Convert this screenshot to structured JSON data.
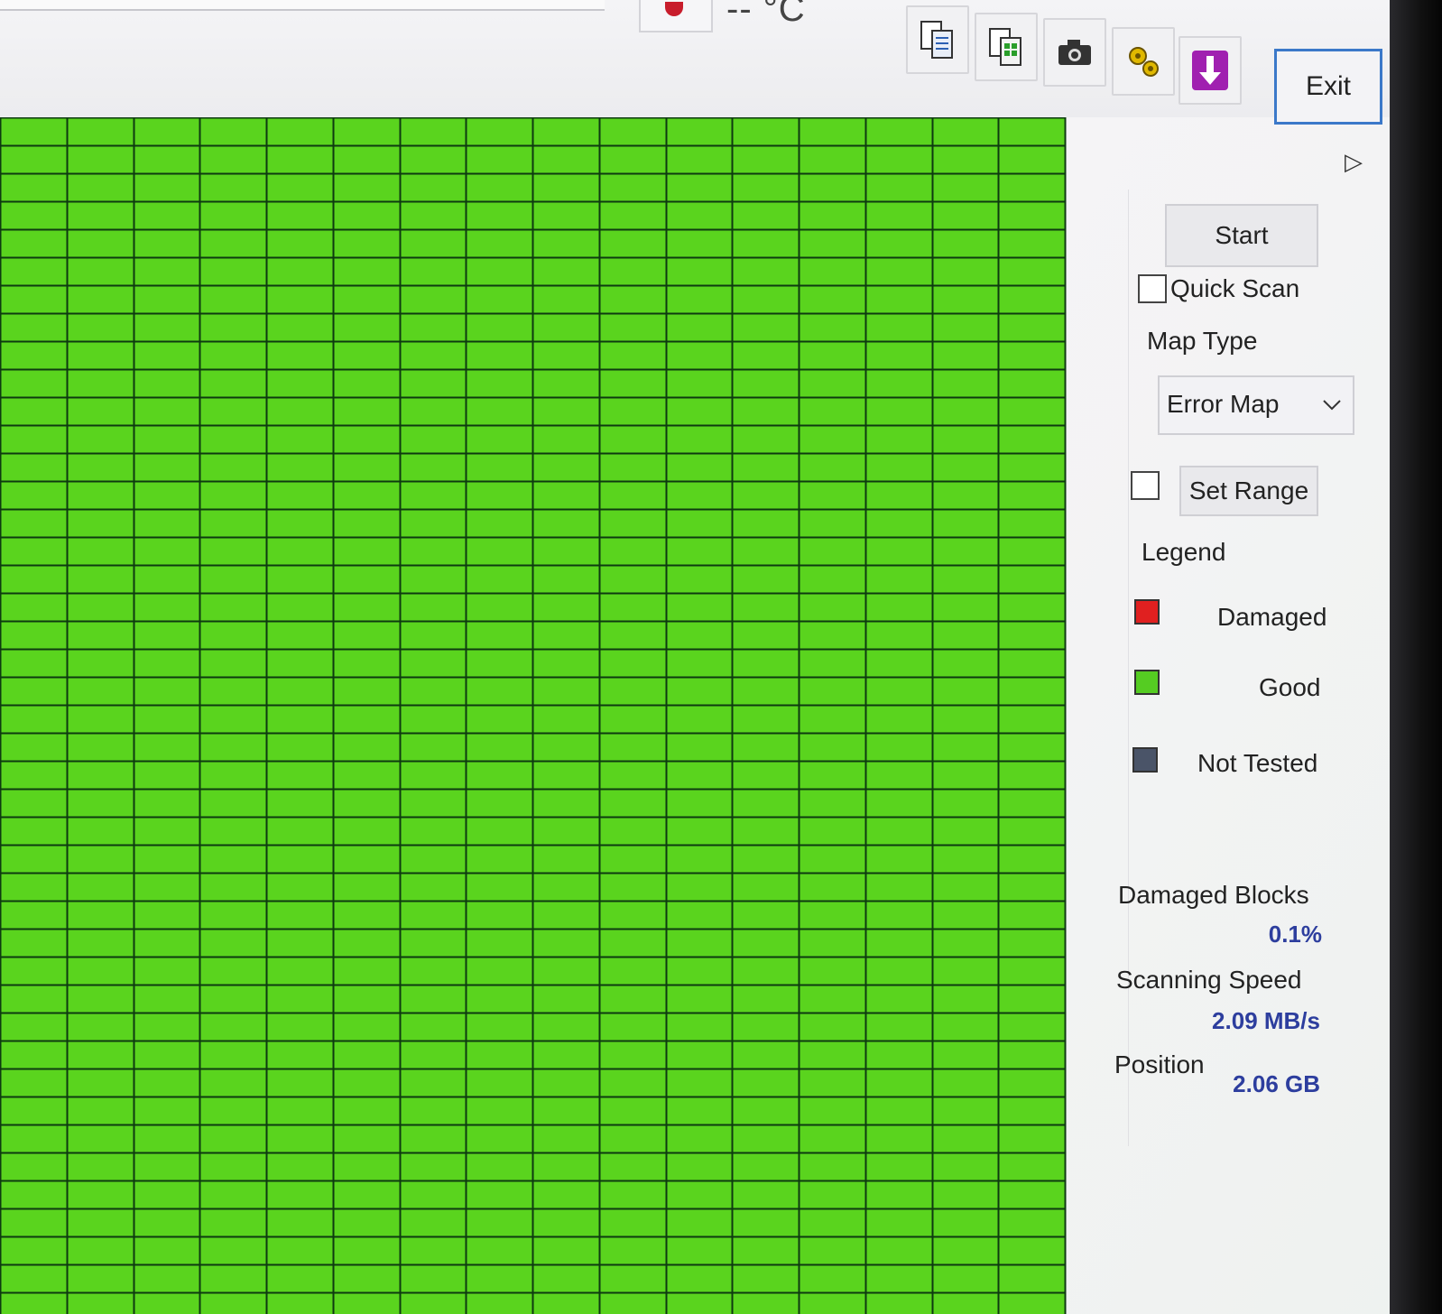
{
  "toolbar": {
    "temperature": "-- °C",
    "exit_label": "Exit",
    "tool_icons": [
      "copy-report-icon",
      "copy-map-icon",
      "camera-icon",
      "settings-gears-icon",
      "download-arrow-icon"
    ],
    "accent_color": "#3b78c9"
  },
  "map": {
    "block_color": "#5ad41e",
    "grid_line_color": "#0d3a10"
  },
  "panel": {
    "start_label": "Start",
    "quick_scan_label": "Quick Scan",
    "quick_scan_checked": false,
    "map_type_label": "Map Type",
    "map_type_value": "Error Map",
    "set_range_checked": false,
    "set_range_label": "Set Range",
    "legend_title": "Legend",
    "legend": [
      {
        "label": "Damaged",
        "color": "#e02020"
      },
      {
        "label": "Good",
        "color": "#55cc22"
      },
      {
        "label": "Not Tested",
        "color": "#4a5468"
      }
    ],
    "stats": {
      "damaged_blocks_label": "Damaged Blocks",
      "damaged_blocks_value": "0.1%",
      "scanning_speed_label": "Scanning Speed",
      "scanning_speed_value": "2.09 MB/s",
      "position_label": "Position",
      "position_value": "2.06 GB"
    }
  }
}
